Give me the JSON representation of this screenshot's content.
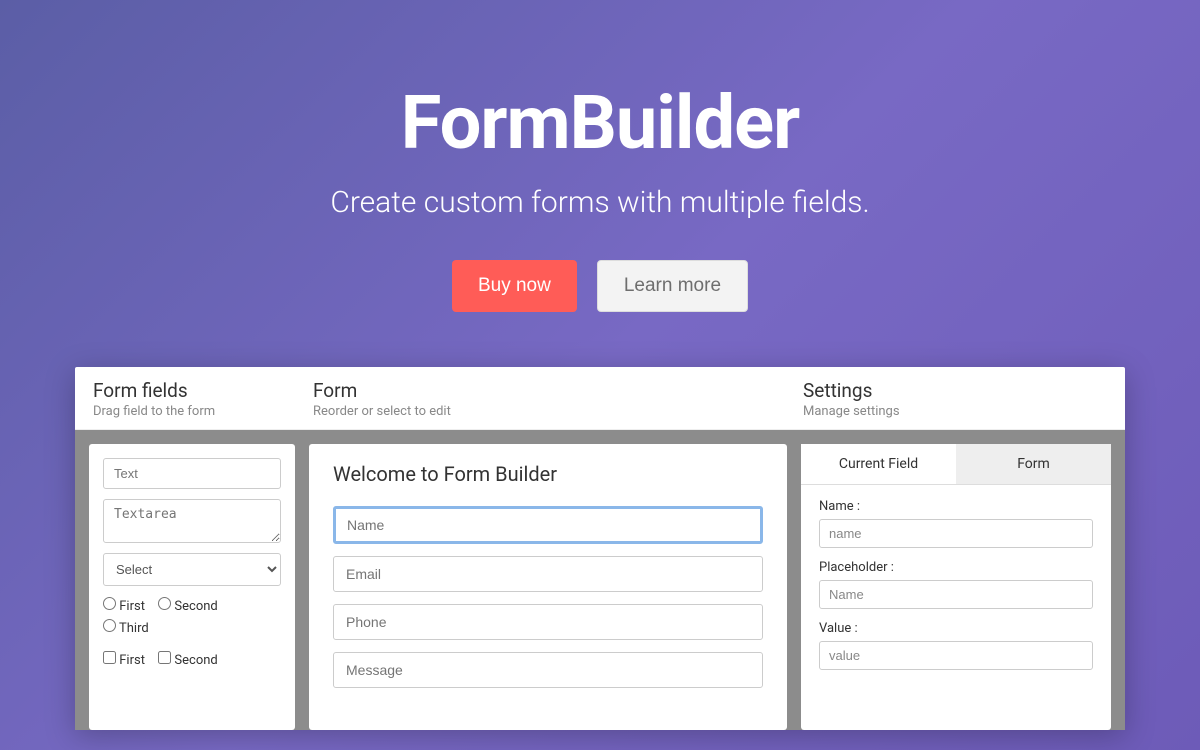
{
  "hero": {
    "title": "FormBuilder",
    "subtitle": "Create custom forms with multiple fields.",
    "buy_label": "Buy now",
    "learn_label": "Learn more"
  },
  "columns": {
    "fields": {
      "title": "Form fields",
      "subtitle": "Drag field to the form"
    },
    "form": {
      "title": "Form",
      "subtitle": "Reorder or select to edit"
    },
    "settings": {
      "title": "Settings",
      "subtitle": "Manage settings"
    }
  },
  "field_palette": {
    "text_placeholder": "Text",
    "textarea_placeholder": "Textarea",
    "select_label": "Select",
    "radio_options": [
      "First",
      "Second",
      "Third"
    ],
    "check_options": [
      "First",
      "Second"
    ]
  },
  "preview_form": {
    "title": "Welcome to Form Builder",
    "inputs": [
      "Name",
      "Email",
      "Phone",
      "Message"
    ]
  },
  "settings_panel": {
    "tabs": [
      "Current Field",
      "Form"
    ],
    "name_label": "Name :",
    "name_value": "name",
    "placeholder_label": "Placeholder :",
    "placeholder_value": "Name",
    "value_label": "Value :",
    "value_value": "value"
  }
}
